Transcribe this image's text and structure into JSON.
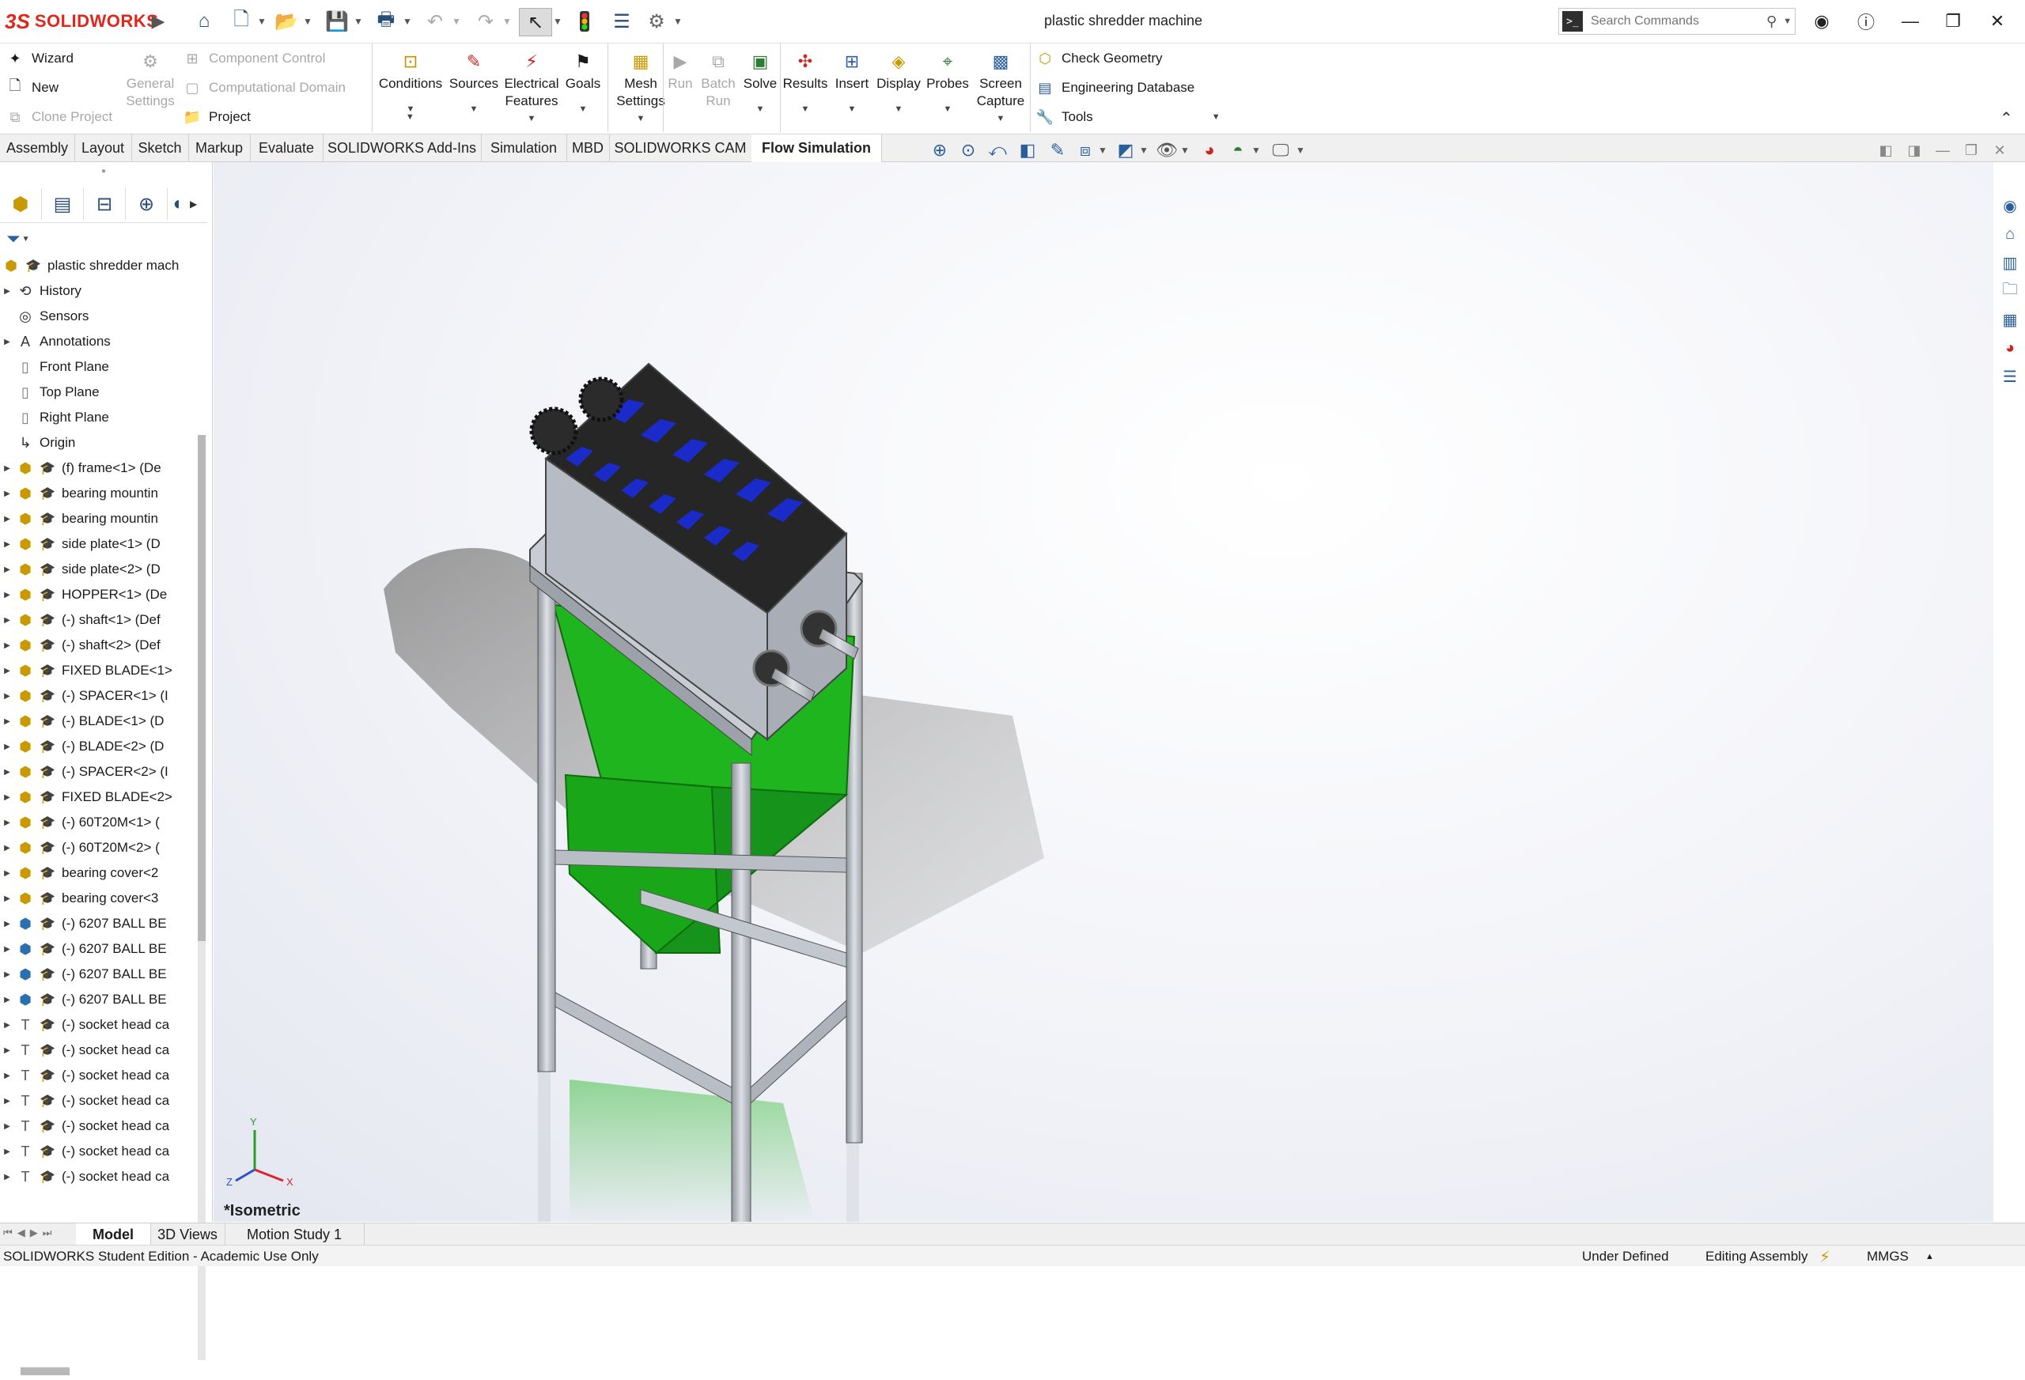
{
  "app": {
    "brand_ds": "3S",
    "brand_name": "SOLIDWORKS",
    "doc_title": "plastic shredder machine"
  },
  "search": {
    "placeholder": "Search Commands"
  },
  "ribbon": {
    "wizard": "Wizard",
    "new": "New",
    "clone_project": "Clone Project",
    "general_settings": "General Settings",
    "component_control": "Component Control",
    "computational_domain": "Computational Domain",
    "project": "Project",
    "conditions": "Conditions",
    "sources": "Sources",
    "electrical_features": "Electrical Features",
    "goals": "Goals",
    "mesh_settings": "Mesh Settings",
    "run": "Run",
    "batch_run": "Batch Run",
    "solve": "Solve",
    "results": "Results",
    "insert": "Insert",
    "display": "Display",
    "probes": "Probes",
    "screen_capture": "Screen Capture",
    "check_geometry": "Check Geometry",
    "engineering_database": "Engineering Database",
    "tools": "Tools"
  },
  "tabs": [
    "Assembly",
    "Layout",
    "Sketch",
    "Markup",
    "Evaluate",
    "SOLIDWORKS Add-Ins",
    "Simulation",
    "MBD",
    "SOLIDWORKS CAM",
    "Flow Simulation"
  ],
  "tree": {
    "root": "plastic shredder mach",
    "items": [
      {
        "label": "History",
        "icon": "history",
        "exp": true
      },
      {
        "label": "Sensors",
        "icon": "sensor",
        "exp": false
      },
      {
        "label": "Annotations",
        "icon": "annotation",
        "exp": true
      },
      {
        "label": "Front Plane",
        "icon": "plane",
        "exp": false
      },
      {
        "label": "Top Plane",
        "icon": "plane",
        "exp": false
      },
      {
        "label": "Right Plane",
        "icon": "plane",
        "exp": false
      },
      {
        "label": "Origin",
        "icon": "origin",
        "exp": false
      },
      {
        "label": "(f) frame<1> (De",
        "icon": "part",
        "exp": true
      },
      {
        "label": "bearing mountin",
        "icon": "part",
        "exp": true
      },
      {
        "label": "bearing mountin",
        "icon": "part",
        "exp": true
      },
      {
        "label": "side plate<1> (D",
        "icon": "part",
        "exp": true
      },
      {
        "label": "side plate<2> (D",
        "icon": "part",
        "exp": true
      },
      {
        "label": "HOPPER<1> (De",
        "icon": "part",
        "exp": true
      },
      {
        "label": "(-) shaft<1> (Def",
        "icon": "part",
        "exp": true
      },
      {
        "label": "(-) shaft<2> (Def",
        "icon": "part",
        "exp": true
      },
      {
        "label": "FIXED BLADE<1>",
        "icon": "part",
        "exp": true
      },
      {
        "label": "(-) SPACER<1> (I",
        "icon": "part",
        "exp": true
      },
      {
        "label": "(-) BLADE<1> (D",
        "icon": "part",
        "exp": true
      },
      {
        "label": "(-) BLADE<2> (D",
        "icon": "part",
        "exp": true
      },
      {
        "label": "(-) SPACER<2> (I",
        "icon": "part",
        "exp": true
      },
      {
        "label": "FIXED BLADE<2>",
        "icon": "part",
        "exp": true
      },
      {
        "label": "(-) 60T20M<1> (",
        "icon": "part",
        "exp": true
      },
      {
        "label": "(-) 60T20M<2> (",
        "icon": "part",
        "exp": true
      },
      {
        "label": "bearing cover<2",
        "icon": "part",
        "exp": true
      },
      {
        "label": "bearing cover<3",
        "icon": "part",
        "exp": true
      },
      {
        "label": "(-) 6207 BALL BE",
        "icon": "assembly",
        "exp": true
      },
      {
        "label": "(-) 6207 BALL BE",
        "icon": "assembly",
        "exp": true
      },
      {
        "label": "(-) 6207 BALL BE",
        "icon": "assembly",
        "exp": true
      },
      {
        "label": "(-) 6207 BALL BE",
        "icon": "assembly",
        "exp": true
      },
      {
        "label": "(-) socket head ca",
        "icon": "bolt",
        "exp": true
      },
      {
        "label": "(-) socket head ca",
        "icon": "bolt",
        "exp": true
      },
      {
        "label": "(-) socket head ca",
        "icon": "bolt",
        "exp": true
      },
      {
        "label": "(-) socket head ca",
        "icon": "bolt",
        "exp": true
      },
      {
        "label": "(-) socket head ca",
        "icon": "bolt",
        "exp": true
      },
      {
        "label": "(-) socket head ca",
        "icon": "bolt",
        "exp": true
      },
      {
        "label": "(-) socket head ca",
        "icon": "bolt",
        "exp": true
      }
    ]
  },
  "viewport": {
    "view_label": "*Isometric",
    "triad": {
      "x": "X",
      "y": "Y",
      "z": "Z"
    }
  },
  "bottom_tabs": [
    "Model",
    "3D Views",
    "Motion Study 1"
  ],
  "status": {
    "edition": "SOLIDWORKS Student Edition - Academic Use Only",
    "defined": "Under Defined",
    "mode": "Editing Assembly",
    "units": "MMGS"
  },
  "colors": {
    "brand": "#e1261c",
    "hopper": "#1fb51f",
    "blades": "#1b2bc9",
    "frame": "#b9bec6"
  }
}
